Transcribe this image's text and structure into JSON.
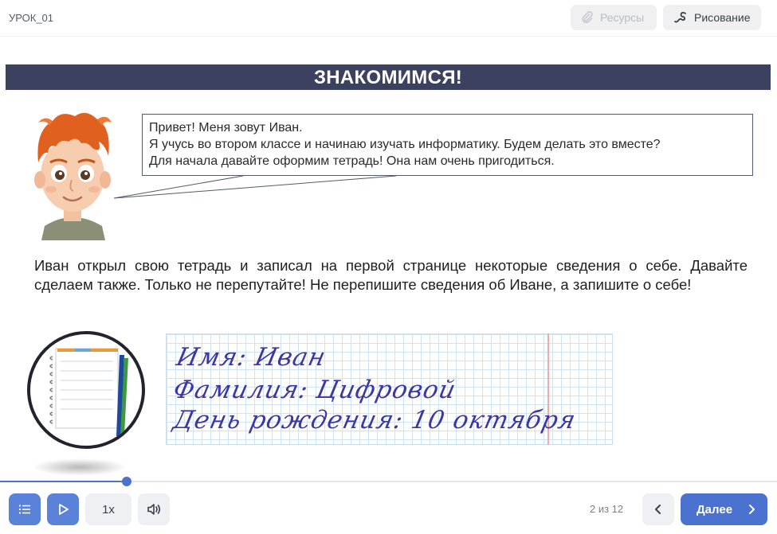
{
  "header": {
    "lesson_title": "УРОК_01",
    "resources_label": "Ресурсы",
    "drawing_label": "Рисование"
  },
  "banner": {
    "title": "ЗНАКОМИМСЯ!"
  },
  "speech": {
    "lines": [
      "Привет! Меня зовут Иван.",
      "Я учусь во втором классе и начинаю изучать информатику. Будем делать это вместе?",
      "Для начала давайте оформим тетрадь!  Она нам очень пригодиться."
    ]
  },
  "main": {
    "paragraph": "Иван открыл свою тетрадь и записал на первой странице некоторые сведения о себе. Давайте сделаем также. Только не перепутайте! Не перепишите сведения об Иване, а запишите о себе!"
  },
  "notebook": {
    "lines": [
      "Имя: Иван",
      "Фамилия: Цифровой",
      "День рождения: 10 октября"
    ]
  },
  "player": {
    "progress_fraction": 0.163,
    "speed_label": "1x",
    "page_counter": "2 из 12",
    "next_label": "Далее"
  },
  "colors": {
    "accent": "#4b72cf",
    "banner": "#3d4160",
    "handwriting": "#3b37a3"
  }
}
